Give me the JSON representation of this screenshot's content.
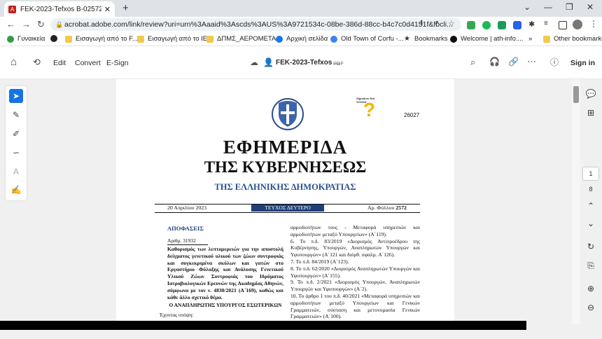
{
  "browser": {
    "tab_title": "FEK-2023-Tefxos B-02572-downl",
    "tab_close": "✕",
    "new_tab": "+",
    "url": "acrobat.adobe.com/link/review?uri=urn%3Aaaid%3Ascds%3AUS%3A9721534c-08be-386d-88cc-b4c7c0d4151f&fbcli...",
    "window_controls": [
      "⌄",
      "—",
      "❐",
      "✕"
    ]
  },
  "bookmarks": [
    {
      "label": "Γυναικεία",
      "color": "#2f9e44"
    },
    {
      "label": "",
      "color": "#222222"
    },
    {
      "label": "Εισαγωγή από το F...",
      "color": "#f2c94c"
    },
    {
      "label": "Εισαγωγή από το IE",
      "color": "#f2c94c"
    },
    {
      "label": "ΔΠΜΣ_ΑΕΡΟΜΕΤΑ...",
      "color": "#f2c94c"
    },
    {
      "label": "Αρχική σελίδα",
      "color": "#1877f2"
    },
    {
      "label": "Old Town of Corfu -...",
      "color": "#3b82f6"
    },
    {
      "label": "Bookmarks",
      "color": "#333333"
    },
    {
      "label": "Welcome | ath-info....",
      "color": "#111111"
    },
    {
      "label": "»",
      "color": ""
    },
    {
      "label": "Other bookmarks",
      "color": "#f2c94c"
    }
  ],
  "acrobat": {
    "menu": [
      "Edit",
      "Convert",
      "E-Sign"
    ],
    "doc_title": "FEK-2023-Tefxos ...",
    "doc_type": "PDF",
    "sign_in": "Sign in"
  },
  "page_nav": {
    "current": "1",
    "total": "8"
  },
  "document": {
    "doc_number": "26027",
    "signature_label": "Signature Not Verified",
    "title_line1": "ΕΦΗΜΕΡΙΔΑ",
    "title_line2": "ΤΗΣ ΚΥΒΕΡΝΗΣΕΩΣ",
    "subtitle": "ΤΗΣ ΕΛΛΗΝΙΚΗΣ ΔΗΜΟΚΡΑΤΙΑΣ",
    "date": "20 Απριλίου 2023",
    "issue": "ΤΕΥΧΟΣ ΔΕΥΤΕΡΟ",
    "sheet_label": "Αρ. Φύλλου",
    "sheet_number": "2572",
    "decisions_heading": "ΑΠΟΦΑΣΕΙΣ",
    "decision_number": "Αριθμ. 31932",
    "decision_title": "Καθορισμός των λεπτομερειών για την αποστολή δείγματος γενετικού υλικού των ζώων συντροφιάς και συγκεκριμένα σκύλων και γατών στο Εργαστήριο Φύλαξης και Ανάλυσης Γενετικού Υλικού Ζώων Συντροφιάς του Ιδρύματος Ιατροβιολογικών Ερευνών της Ακαδημίας Αθηνών, σύμφωνα με τον ν. 4830/2021 (Α΄169), καθώς και κάθε άλλο σχετικό θέμα.",
    "minister_heading": "Ο ΑΝΑΠΛΗΡΩΤΗΣ ΥΠΟΥΡΓΟΣ ΕΣΩΤΕΡΙΚΩΝ",
    "having_regard": "Έχοντας υπόψη:",
    "right_column": "αρμοδιοτήτων τους - Μεταφορά υπηρεσιών και αρμοδιοτήτων μεταξύ Υπουργείων» (Α΄119).\n6. Το π.δ. 83/2019 «Διορισμός Αντιπροέδρου της Κυβέρνησης, Υπουργών, Αναπληρωτών Υπουργών και Υφυπουργών» (Α΄121 και διόρθ. σφαλμ. Α΄126).\n7. Το π.δ. 84/2019 (Α΄123).\n8. Το π.δ. 62/2020 «Διορισμός Αναπληρωτών Υπουργών και Υφυπουργών» (Α΄155).\n9. Το π.δ. 2/2021 «Διορισμός Υπουργών, Αναπληρωτών Υπουργών και Υφυπουργών» (Α΄2).\n10. Το άρθρο 1 του π.δ. 40/2021 «Μεταφορά υπηρεσιών και αρμοδιοτήτων μεταξύ Υπουργείων και Γενικών Γραμματειών, σύσταση και μετονομασία Γενικών Γραμματειών» (Α΄100)."
  }
}
